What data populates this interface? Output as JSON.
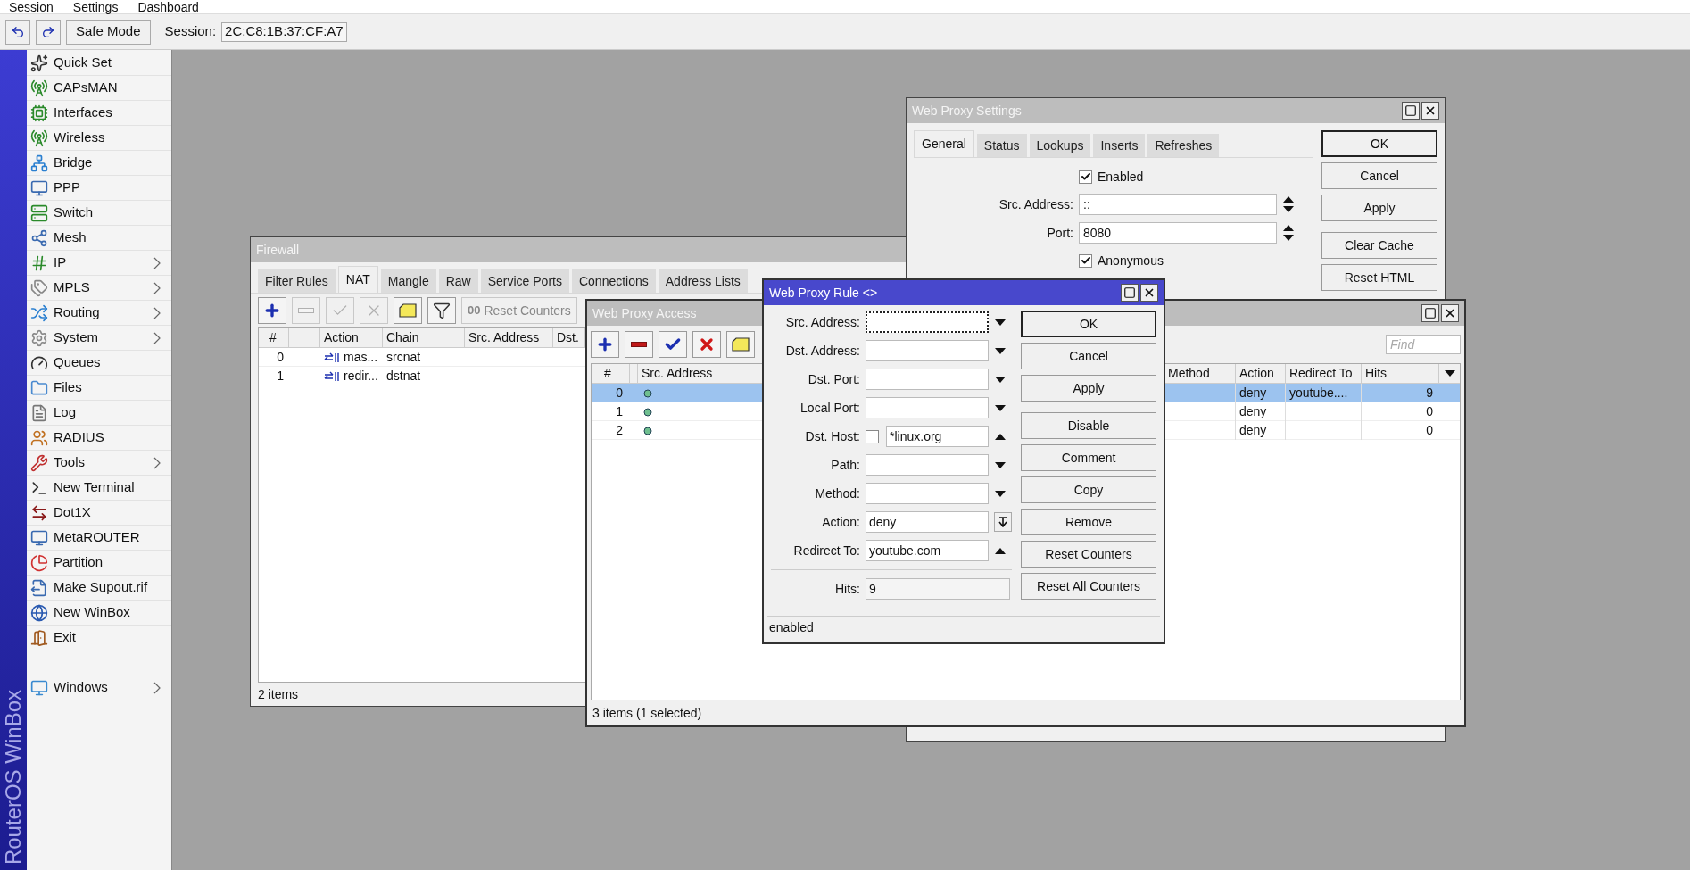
{
  "menu_bar": [
    "Session",
    "Settings",
    "Dashboard"
  ],
  "toolbar": {
    "safe_mode": "Safe Mode",
    "session_label": "Session:",
    "session_value": "2C:C8:1B:37:CF:A7"
  },
  "sidebar": {
    "brand": "RouterOS WinBox",
    "items": [
      {
        "label": "Quick Set",
        "submenu": false
      },
      {
        "label": "CAPsMAN",
        "submenu": false
      },
      {
        "label": "Interfaces",
        "submenu": false
      },
      {
        "label": "Wireless",
        "submenu": false
      },
      {
        "label": "Bridge",
        "submenu": false
      },
      {
        "label": "PPP",
        "submenu": false
      },
      {
        "label": "Switch",
        "submenu": false
      },
      {
        "label": "Mesh",
        "submenu": false
      },
      {
        "label": "IP",
        "submenu": true
      },
      {
        "label": "MPLS",
        "submenu": true
      },
      {
        "label": "Routing",
        "submenu": true
      },
      {
        "label": "System",
        "submenu": true
      },
      {
        "label": "Queues",
        "submenu": false
      },
      {
        "label": "Files",
        "submenu": false
      },
      {
        "label": "Log",
        "submenu": false
      },
      {
        "label": "RADIUS",
        "submenu": false
      },
      {
        "label": "Tools",
        "submenu": true
      },
      {
        "label": "New Terminal",
        "submenu": false
      },
      {
        "label": "Dot1X",
        "submenu": false
      },
      {
        "label": "MetaROUTER",
        "submenu": false
      },
      {
        "label": "Partition",
        "submenu": false
      },
      {
        "label": "Make Supout.rif",
        "submenu": false
      },
      {
        "label": "New WinBox",
        "submenu": false
      },
      {
        "label": "Exit",
        "submenu": false
      }
    ],
    "bottom_items": [
      {
        "label": "Windows",
        "submenu": true
      }
    ]
  },
  "firewall": {
    "title": "Firewall",
    "active": false,
    "tabs": [
      {
        "label": "Filter Rules",
        "selected": false
      },
      {
        "label": "NAT",
        "selected": true
      },
      {
        "label": "Mangle",
        "selected": false
      },
      {
        "label": "Raw",
        "selected": false
      },
      {
        "label": "Service Ports",
        "selected": false
      },
      {
        "label": "Connections",
        "selected": false
      },
      {
        "label": "Address Lists",
        "selected": false
      }
    ],
    "tools": [
      {
        "kind": "add",
        "disabled": false
      },
      {
        "kind": "remove",
        "disabled": true
      },
      {
        "kind": "enable",
        "disabled": true
      },
      {
        "kind": "disable",
        "disabled": true
      },
      {
        "kind": "comment",
        "disabled": false
      },
      {
        "kind": "filter",
        "disabled": false
      }
    ],
    "reset_counters": {
      "prefix": "00",
      "label": "Reset Counters"
    },
    "columns": [
      "#",
      "Action",
      "Chain",
      "Src. Address",
      "Dst."
    ],
    "rows": [
      {
        "number": "0",
        "action": "mas...",
        "chain": "srcnat",
        "selected": false
      },
      {
        "number": "1",
        "action": "redir...",
        "chain": "dstnat",
        "selected": false
      }
    ],
    "status": "2 items"
  },
  "web_proxy_settings": {
    "title": "Web Proxy Settings",
    "active": false,
    "tabs": [
      {
        "label": "General",
        "selected": true
      },
      {
        "label": "Status",
        "selected": false
      },
      {
        "label": "Lookups",
        "selected": false
      },
      {
        "label": "Inserts",
        "selected": false
      },
      {
        "label": "Refreshes",
        "selected": false
      }
    ],
    "fields": [
      {
        "kind": "checkbox",
        "label": "Enabled",
        "checked": true
      },
      {
        "kind": "spin",
        "label": "Src. Address:",
        "value": "::"
      },
      {
        "kind": "spin",
        "label": "Port:",
        "value": "8080"
      },
      {
        "kind": "checkbox",
        "label": "Anonymous",
        "checked": true
      }
    ],
    "buttons": [
      "OK",
      "Cancel",
      "Apply",
      "Clear Cache",
      "Reset HTML"
    ]
  },
  "web_proxy_access": {
    "title": "Web Proxy Access",
    "active": false,
    "tools": [
      {
        "kind": "add",
        "disabled": false
      },
      {
        "kind": "remove",
        "disabled": false
      },
      {
        "kind": "enable",
        "disabled": false
      },
      {
        "kind": "disable",
        "disabled": false
      },
      {
        "kind": "comment",
        "disabled": false
      }
    ],
    "find_placeholder": "Find",
    "columns": [
      "#",
      "Src. Address",
      "Method",
      "Action",
      "Redirect To",
      "Hits"
    ],
    "rows": [
      {
        "number": "0",
        "selected": true,
        "action": "deny",
        "redirect_to": "youtube....",
        "hits": "9"
      },
      {
        "number": "1",
        "selected": false,
        "action": "deny",
        "hits": "0"
      },
      {
        "number": "2",
        "selected": false,
        "action": "deny",
        "hits": "0"
      }
    ],
    "status": "3 items (1 selected)"
  },
  "web_proxy_rule": {
    "title": "Web Proxy Rule <>",
    "active": true,
    "fields": [
      {
        "kind": "text",
        "label": "Src. Address:",
        "focused": true,
        "expanded": false
      },
      {
        "kind": "text",
        "label": "Dst. Address:",
        "focused": false,
        "expanded": false
      },
      {
        "kind": "text",
        "label": "Dst. Port:",
        "focused": false,
        "expanded": false
      },
      {
        "kind": "text",
        "label": "Local Port:",
        "focused": false,
        "expanded": false
      },
      {
        "kind": "host",
        "label": "Dst. Host:",
        "focused": false,
        "checked": false,
        "value": "*linux.org",
        "expanded": true
      },
      {
        "kind": "text",
        "label": "Path:",
        "focused": false,
        "expanded": false
      },
      {
        "kind": "text",
        "label": "Method:",
        "focused": false,
        "expanded": false
      },
      {
        "kind": "select",
        "label": "Action:",
        "focused": false,
        "value": "deny"
      },
      {
        "kind": "text",
        "label": "Redirect To:",
        "focused": false,
        "value": "youtube.com",
        "expanded": true
      },
      {
        "kind": "readonly",
        "label": "Hits:",
        "focused": false,
        "value": "9"
      }
    ],
    "buttons": [
      "OK",
      "Cancel",
      "Apply",
      "Disable",
      "Comment",
      "Copy",
      "Remove",
      "Reset Counters",
      "Reset All Counters"
    ],
    "status": "enabled"
  }
}
